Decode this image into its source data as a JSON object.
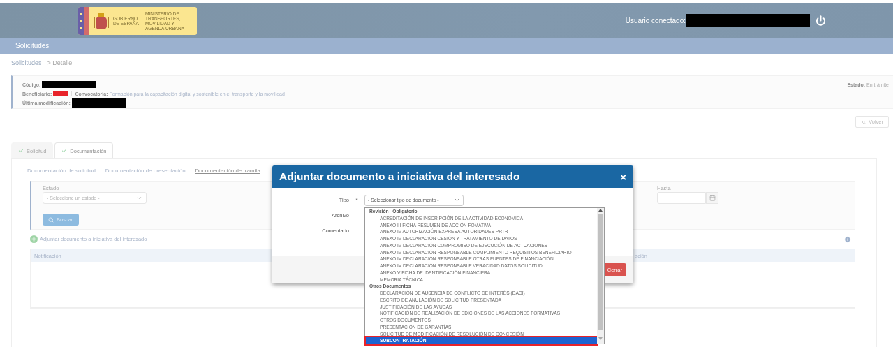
{
  "header": {
    "logo_left": "GOBIERNO DE ESPAÑA",
    "logo_right": "MINISTERIO DE TRANSPORTES, MOVILIDAD Y AGENDA URBANA",
    "user_label": "Usuario conectado:"
  },
  "nav": {
    "items": [
      {
        "label": "Solicitudes"
      }
    ]
  },
  "breadcrumb": [
    "Solicitudes",
    "> Detalle"
  ],
  "summary": {
    "codigo_label": "Código:",
    "beneficiario_label": "Beneficiario:",
    "convocatoria_label": "Convocatoria:",
    "convocatoria_value": "Formación para la capacitación digital y sostenible en el transporte y la movilidad",
    "ultima_label": "Última modificación:",
    "estado_label": "Estado:",
    "estado_value": "En trámite"
  },
  "back_button": "Volver",
  "tabs": [
    {
      "label": "Solicitud",
      "selected": false
    },
    {
      "label": "Documentación",
      "selected": true
    }
  ],
  "subtabs": [
    {
      "label": "Documentación de solicitud",
      "selected": false
    },
    {
      "label": "Documentación de presentación",
      "selected": false
    },
    {
      "label": "Documentación de tramita",
      "selected": true
    }
  ],
  "filters": {
    "estado_label": "Estado",
    "estado_placeholder": "- Seleccione un estado -",
    "hasta_label": "Hasta",
    "search_button": "Buscar"
  },
  "add_link": "Adjuntar documento a iniciativa del interesado",
  "table": {
    "columns": [
      "Notificación",
      "ación"
    ]
  },
  "modal": {
    "title": "Adjuntar documento a iniciativa del interesado",
    "close_icon": "×",
    "required_mark": "*",
    "fields": [
      {
        "label": "Tipo",
        "required": true
      },
      {
        "label": "Archivo",
        "required": false
      },
      {
        "label": "Comentario",
        "required": false
      }
    ],
    "type_select": "- Seleccionar tipo de documento -",
    "close_button": "Cerrar",
    "option_groups": [
      {
        "label": "Revisión - Obligatorio",
        "children": [
          {
            "label": "ACREDITACIÓN DE INSCRIPCIÓN DE LA ACTIVIDAD ECONÓMICA",
            "selected": false
          },
          {
            "label": "ANEXO III FICHA RESUMEN DE ACCIÓN FOMATIVA",
            "selected": false
          },
          {
            "label": "ANEXO IV AUTORIZACIÓN EXPRESA AUTORIDADES PRTR",
            "selected": false
          },
          {
            "label": "ANEXO IV DECLARACIÓN CESIÓN Y TRATAMIENTO DE DATOS",
            "selected": false
          },
          {
            "label": "ANEXO IV DECLARACIÓN COMPROMISO DE EJECUCIÓN DE ACTUACIONES",
            "selected": false
          },
          {
            "label": "ANEXO IV DECLARACIÓN RESPONSABLE CUMPLIMIENTO REQUISITOS BENEFICIARIO",
            "selected": false
          },
          {
            "label": "ANEXO IV DECLARACIÓN RESPONSABLE OTRAS FUENTES DE FINANCIACIÓN",
            "selected": false
          },
          {
            "label": "ANEXO IV DECLARACIÓN RESPONSABLE VERACIDAD DATOS SOLICITUD",
            "selected": false
          },
          {
            "label": "ANEXO V FICHA DE IDENTIFICACIÓN FINANCIERA",
            "selected": false
          },
          {
            "label": "MEMORIA TÉCNICA",
            "selected": false
          }
        ]
      },
      {
        "label": "Otros Documentos",
        "children": [
          {
            "label": "DECLARACIÓN DE AUSENCIA DE CONFLICTO DE INTERÉS (DACI)",
            "selected": false
          },
          {
            "label": "ESCRITO DE ANULACIÓN DE SOLICITUD PRESENTADA",
            "selected": false
          },
          {
            "label": "JUSTIFICACIÓN DE LAS AYUDAS",
            "selected": false
          },
          {
            "label": "NOTIFICACIÓN DE REALIZACIÓN DE EDICIONES DE LAS ACCIONES FORMATIVAS",
            "selected": false
          },
          {
            "label": "OTROS DOCUMENTOS",
            "selected": false
          },
          {
            "label": "PRESENTACIÓN DE GARANTÍAS",
            "selected": false
          },
          {
            "label": "SOLICITUD DE MODIFICACIÓN DE RESOLUCIÓN DE CONCESIÓN",
            "selected": false
          },
          {
            "label": "SUBCONTRATACIÓN",
            "selected": true
          }
        ]
      }
    ]
  }
}
